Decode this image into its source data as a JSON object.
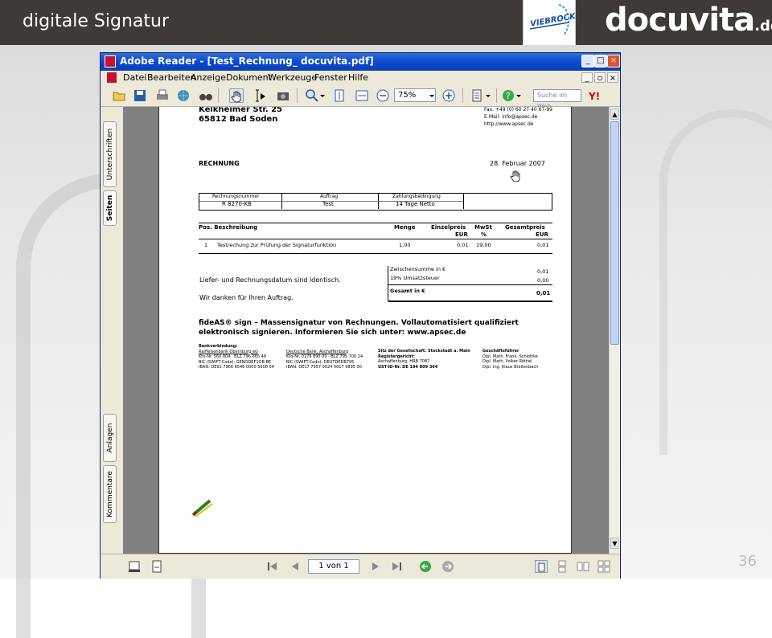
{
  "slide": {
    "title": "digitale Signatur",
    "logo_viebrock": "VIEBROCK",
    "logo_docuvita_main": "docuvita",
    "logo_docuvita_tld": ".de",
    "number": "36"
  },
  "window": {
    "title": "Adobe Reader - [Test_Rechnung_ docuvita.pdf]",
    "menu": [
      "Datei",
      "Bearbeiten",
      "Anzeige",
      "Dokument",
      "Werkzeuge",
      "Fenster",
      "Hilfe"
    ],
    "zoom": "75%",
    "search_placeholder": "Suche im Web",
    "side_tabs": [
      "Unterschriften",
      "Seiten",
      "Anlagen",
      "Kommentare"
    ],
    "page_indicator": "1 von 1"
  },
  "invoice": {
    "sender_street": "Kelkheimer Str. 25",
    "sender_city": "65812 Bad Soden",
    "fax": "Fax. +49 (0) 60 27 40 67-99",
    "email": "E-Mail: info@apsec.de",
    "web": "http://www.apsec.de",
    "heading": "RECHNUNG",
    "date": "28. Februar 2007",
    "info_headers": [
      "Rechnungsnummer",
      "Auftrag",
      "Zahlungsbedingung",
      ""
    ],
    "info_values": [
      "R 8270-KB",
      "Test",
      "14 Tage Netto",
      ""
    ],
    "item_headers": {
      "pos": "Pos. Beschreibung",
      "menge": "Menge",
      "einzel": "Einzelpreis",
      "einzel_unit": "EUR",
      "mwst": "MwSt",
      "mwst_unit": "%",
      "gesamt": "Gesamtpreis",
      "gesamt_unit": "EUR"
    },
    "item": {
      "pos": "1",
      "desc": "Testrechung zur Prüfung der Signaturfunktion",
      "menge": "1,00",
      "einzel": "0,01",
      "mwst": "19,00",
      "gesamt": "0,01"
    },
    "note1": "Liefer- und Rechnungsdatum sind identisch.",
    "note2": "Wir danken für Ihren Auftrag.",
    "totals": {
      "zwischen_label": "Zwischensumme in €",
      "zwischen_value": "0,01",
      "ust_label": "19% Umsatzsteuer",
      "ust_value": "0,00",
      "gesamt_label": "Gesamt in €",
      "gesamt_value": "0,01"
    },
    "promo_line1": "fideAS® sign – Massensignatur von Rechnungen. Vollautomatisiert qualifiziert",
    "promo_line2": "elektronisch signieren. Informieren Sie sich unter: www.apsec.de",
    "footer": {
      "col1": [
        "Bankverbindung:",
        "Raiffeisenbank Obernburg eG",
        "Kto-Nr. 560 804 · BLZ 796 665 48",
        "BIC (SWIFT-Code): GENODEF1OB BE",
        "IBAN: DE91 7966 6548 0000 5608 04"
      ],
      "col2": [
        "",
        "Deutsche Bank, Aschaffenburg",
        "Kto-Nr. 0179 895 00 · BLZ 795 700 24",
        "BIC (SWIFT-Code): DEUTDEDB795",
        "IBAN: DE17 7957 0024 0017 9895 00"
      ],
      "col3": [
        "Sitz der Gesellschaft: Stockstadt a. Main",
        "Registergericht:",
        "Aschaffenburg, HRB 7087",
        "UST-ID-Nr. DE 194 809 364"
      ],
      "col4": [
        "Geschäftsführer",
        "Dipl. Math. Frank. Schlottke",
        "Dipl. Math. Volker Röthel",
        "Dipl. Ing. Klaus Breitenbach"
      ]
    }
  }
}
